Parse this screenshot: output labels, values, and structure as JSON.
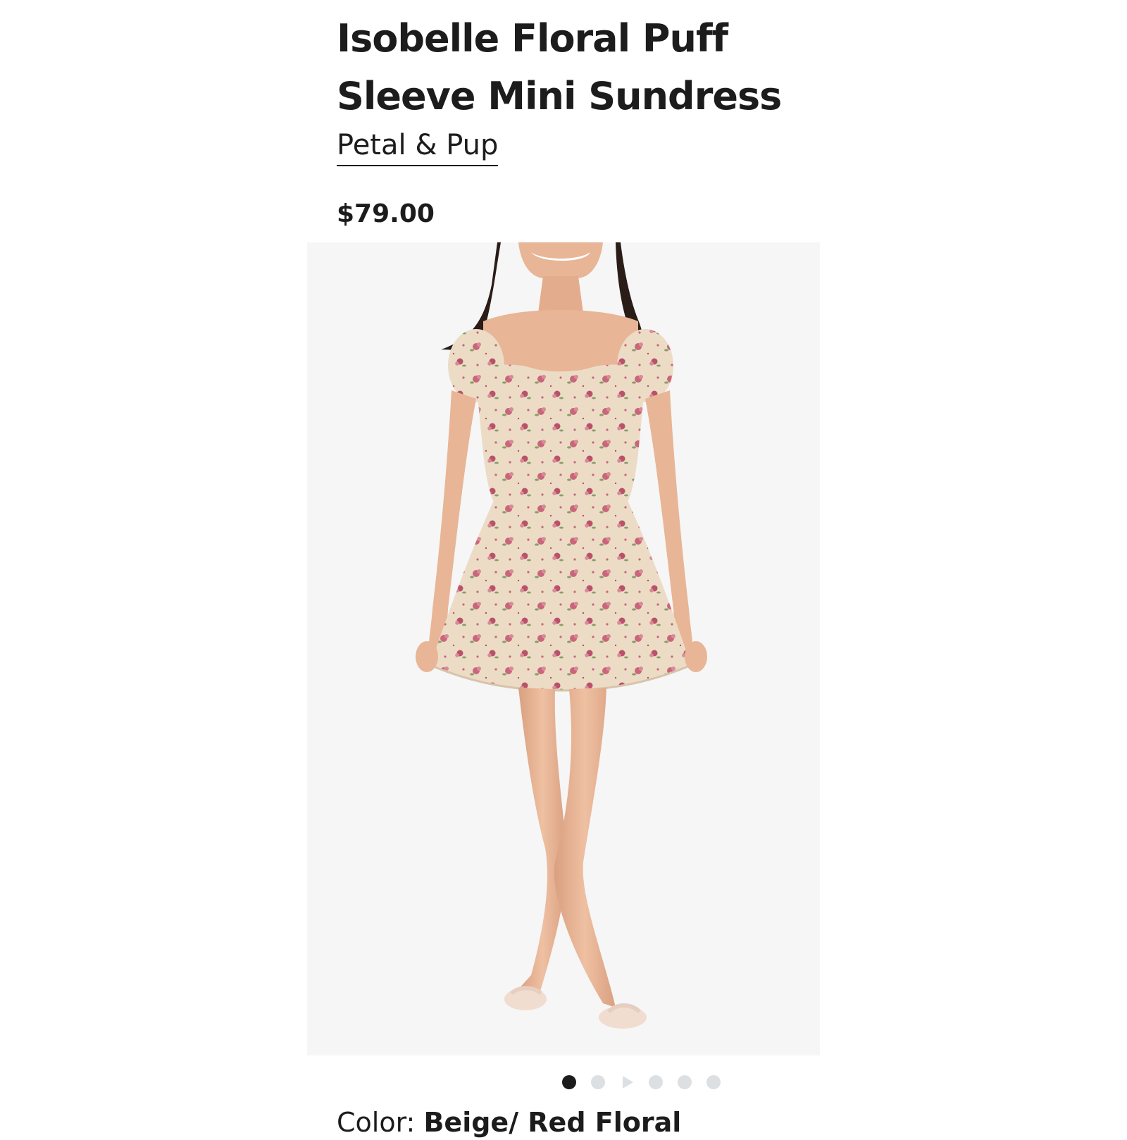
{
  "product": {
    "title": "Isobelle Floral Puff Sleeve Mini Sundress",
    "brand": "Petal & Pup",
    "price": "$79.00",
    "color_label": "Color:",
    "color_value": "Beige/ Red Floral"
  },
  "gallery": {
    "image_count": 6,
    "active_index": 1,
    "video_slide_index": 3,
    "background": "#f6f6f6",
    "dress_color": "#ecdcc6",
    "flower_color": "#c9667a",
    "leaf_color": "#8a9e6a",
    "skin_color": "#e8b596",
    "hair_color": "#2a1d18"
  }
}
